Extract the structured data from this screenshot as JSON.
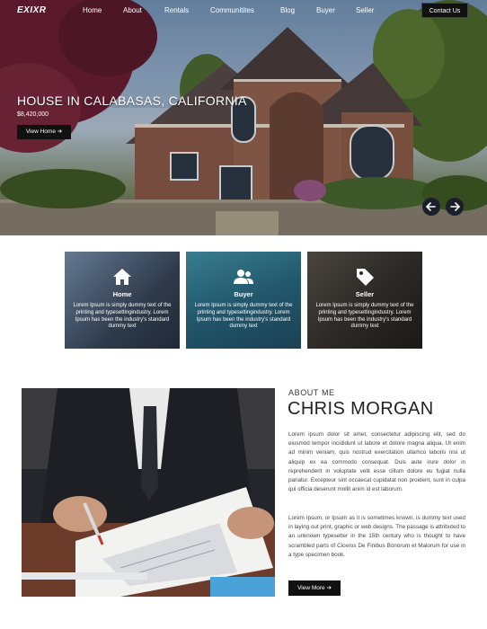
{
  "header": {
    "logo": "EXIXR",
    "nav": [
      "Home",
      "About",
      "Rentals",
      "Communitites",
      "Blog",
      "Buyer",
      "Seller"
    ],
    "contact_label": "Contact Us"
  },
  "hero": {
    "title": "HOUSE IN CALABASAS, CALIFORNIA",
    "price": "$8,420,000",
    "button_label": "View Home ➔",
    "prev_icon": "arrow-left-icon",
    "next_icon": "arrow-right-icon"
  },
  "cards": [
    {
      "title": "Home",
      "icon": "home-icon",
      "text": "Lorem Ipsum is simply dummy text of the printing and typesettingindustry. Lorem Ipsum has been the industry's standard dummy text"
    },
    {
      "title": "Buyer",
      "icon": "users-icon",
      "text": "Lorem Ipsum is simply dummy text of the printing and typesettingindustry. Lorem Ipsum has been the industry's standard dummy text"
    },
    {
      "title": "Seller",
      "icon": "tag-icon",
      "text": "Lorem Ipsum is simply dummy text of the printing and typesettingindustry. Lorem Ipsum has been the industry's standard dummy text"
    }
  ],
  "about": {
    "label": "ABOUT ME",
    "name": "CHRIS MORGAN",
    "paragraph1": "Lorem ipsum dolor sit amet, consectetur adipiscing elit, sed do eiusmod tempor incididunt ut labore et dolore magna aliqua. Ut enim ad minim veniam, quis nostrud exercitation ullamco laboris nisi ut aliquip ex ea commodo consequat. Duis aute irure dolor in reprehenderit in voluptate velit esse cillum dolore eu fugiat nulla pariatur. Excepteur sint occaecat cupidatat non proident, sunt in culpa qui officia deserunt mollit anim id est laborum.",
    "paragraph2": "Lorem Ipsum, or Ipsum as it is sometimes known, is dummy text used in laying out print, graphic or web designs. The passage is attributed to an unknown typesetter in the 15th century who is thought to have scrambled parts of Ciceros De Finibus Bonorum et Malorum for use in a type specimen book.",
    "button_label": "View More ➔"
  }
}
